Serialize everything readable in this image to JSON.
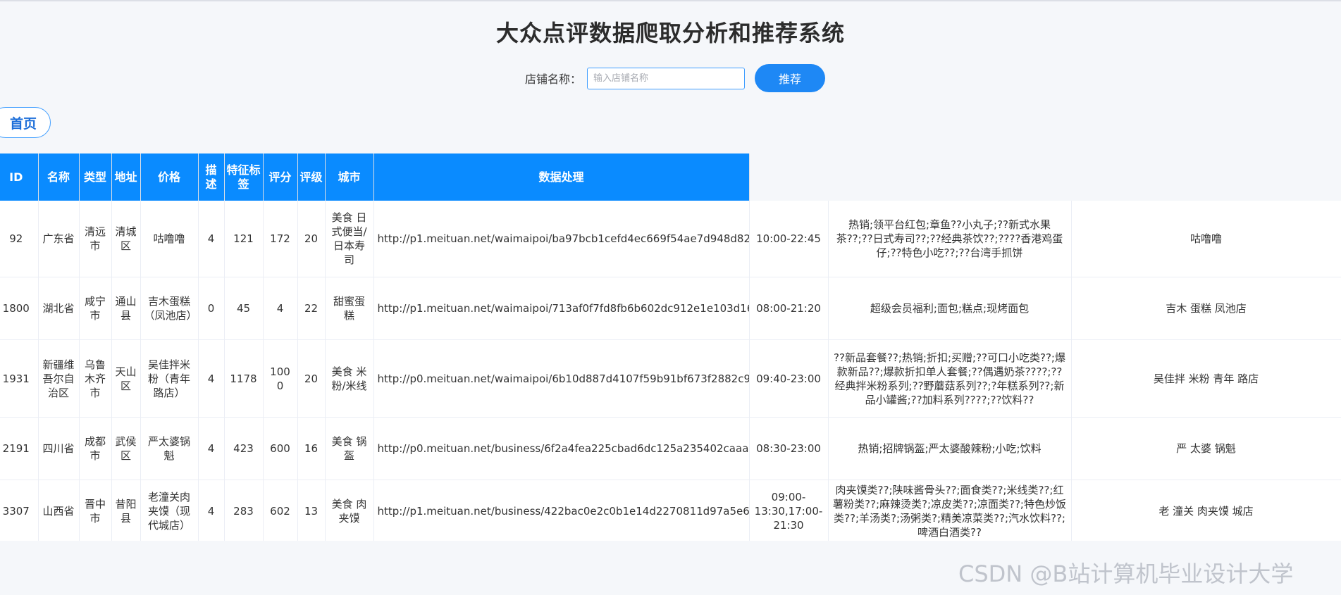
{
  "page": {
    "title": "大众点评数据爬取分析和推荐系统",
    "search_label": "店铺名称：",
    "search_placeholder": "输入店铺名称",
    "recommend_button": "推荐",
    "home_button": "首页",
    "watermark": "CSDN @B站计算机毕业设计大学"
  },
  "table": {
    "headers": [
      "ID",
      "名称",
      "类型",
      "地址",
      "价格",
      "描述",
      "特征标签",
      "评分",
      "评级",
      "城市",
      "数据处理"
    ],
    "rows": [
      [
        "92",
        "广东省",
        "清远市",
        "清城区",
        "咕噜噜",
        "4",
        "121",
        "172",
        "20",
        "美食 日式便当/日本寿司",
        "http://p1.meituan.net/waimaipoi/ba97bcb1cefd4ec669f54ae7d948d827231315.jpg.webp",
        "10:00-22:45",
        "热销;领平台红包;章鱼??小丸子;??新式水果茶??;??日式寿司??;??经典茶饮??;????香港鸡蛋仔;??特色小吃??;??台湾手抓饼",
        "咕噜噜"
      ],
      [
        "1800",
        "湖北省",
        "咸宁市",
        "通山县",
        "吉木蛋糕（凤池店）",
        "0",
        "45",
        "4",
        "22",
        "甜蜜蛋糕",
        "http://p1.meituan.net/waimaipoi/713af0f7fd8fb6b602dc912e1e103d1615630.jpg",
        "08:00-21:20",
        "超级会员福利;面包;糕点;现烤面包",
        "吉木 蛋糕 凤池店"
      ],
      [
        "1931",
        "新疆维吾尔自治区",
        "乌鲁木齐市",
        "天山区",
        "吴佳拌米粉（青年路店）",
        "4",
        "1178",
        "1000",
        "20",
        "美食 米粉/米线",
        "http://p0.meituan.net/waimaipoi/6b10d887d4107f59b91bf673f2882c91303937.jpg",
        "09:40-23:00",
        "??新品套餐??;热销;折扣;买赠;??可口小吃类??;爆款新品??;爆款折扣单人套餐;??偶遇奶茶????;??经典拌米粉系列;??野蘑菇系列??;?年糕系列??;新品小罐酱;??加料系列????;??饮料??",
        "吴佳拌 米粉 青年 路店"
      ],
      [
        "2191",
        "四川省",
        "成都市",
        "武侯区",
        "严太婆锅魁",
        "4",
        "423",
        "600",
        "16",
        "美食 锅盔",
        "http://p0.meituan.net/business/6f2a4fea225cbad6dc125a235402caaa133468.jpg",
        "08:30-23:00",
        "热销;招牌锅盔;严太婆酸辣粉;小吃;饮料",
        "严 太婆 锅魁"
      ],
      [
        "3307",
        "山西省",
        "晋中市",
        "昔阳县",
        "老潼关肉夹馍（现代城店）",
        "4",
        "283",
        "602",
        "13",
        "美食 肉夹馍",
        "http://p1.meituan.net/business/422bac0e2c0b1e14d2270811d97a5e6d13744.jpg",
        "09:00-13:30,17:00-21:30",
        "肉夹馍类??;陕味酱骨头??;面食类??;米线类??;红薯粉类??;麻辣烫类?;凉皮类??;凉面类??;特色炒饭类??;羊汤类?;汤粥类?;精美凉菜类??;汽水饮料??;啤酒白酒类??",
        "老 潼关 肉夹馍 城店"
      ]
    ]
  },
  "colors": {
    "header_bg": "#0a8bff",
    "accent": "#1e88f5",
    "page_bg": "#f5f7fa"
  }
}
